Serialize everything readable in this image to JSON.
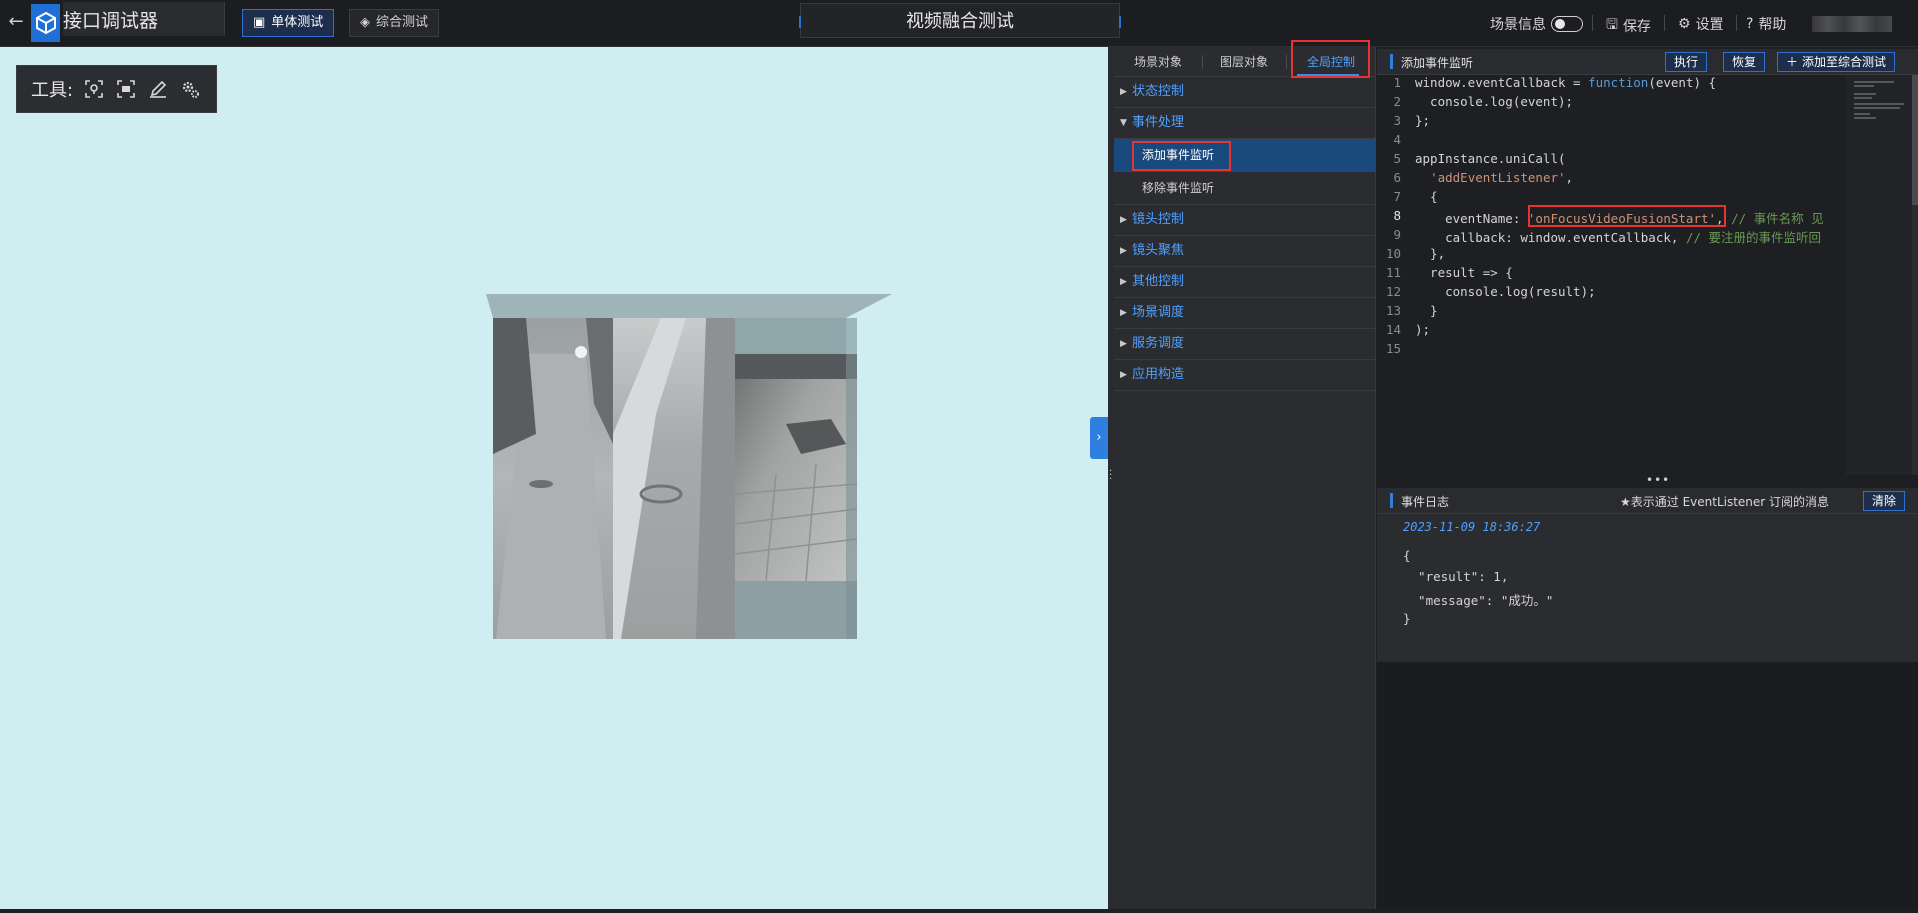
{
  "header": {
    "app_title": "接口调试器",
    "mode_single": "单体测试",
    "mode_combined": "综合测试",
    "page_title": "视频融合测试",
    "scene_info_label": "场景信息",
    "save_label": "保存",
    "settings_label": "设置",
    "help_label": "帮助"
  },
  "toolbox": {
    "label": "工具:"
  },
  "tree": {
    "tabs": [
      "场景对象",
      "图层对象",
      "全局控制"
    ],
    "active_tab": "全局控制",
    "items": [
      {
        "label": "状态控制",
        "expanded": false
      },
      {
        "label": "事件处理",
        "expanded": true
      },
      {
        "label": "镜头控制",
        "expanded": false
      },
      {
        "label": "镜头聚焦",
        "expanded": false
      },
      {
        "label": "其他控制",
        "expanded": false
      },
      {
        "label": "场景调度",
        "expanded": false
      },
      {
        "label": "服务调度",
        "expanded": false
      },
      {
        "label": "应用构造",
        "expanded": false
      }
    ],
    "subitems": [
      "添加事件监听",
      "移除事件监听"
    ],
    "selected_sub": "添加事件监听"
  },
  "editor": {
    "title": "添加事件监听",
    "run_label": "执行",
    "restore_label": "恢复",
    "add_label": "添加至综合测试",
    "current_line": 8,
    "lines": [
      "window.eventCallback = function(event) {",
      "  console.log(event);",
      "};",
      "",
      "appInstance.uniCall(",
      "  'addEventListener',",
      "  {",
      "    eventName: 'onFocusVideoFusionStart', // 事件名称 见",
      "    callback: window.eventCallback, // 要注册的事件监听回",
      "  },",
      "  result => {",
      "    console.log(result);",
      "  }",
      ");",
      ""
    ]
  },
  "log": {
    "title": "事件日志",
    "note": "★表示通过 EventListener 订阅的消息",
    "clear_label": "清除",
    "timestamp": "2023-11-09 18:36:27",
    "lines": [
      "{",
      "  \"result\": 1,",
      "  \"message\": \"成功。\"",
      "}"
    ]
  },
  "colors": {
    "accent": "#2f7fe0",
    "highlight_box": "#e8332e",
    "viewport_bg": "#d0edf2"
  }
}
